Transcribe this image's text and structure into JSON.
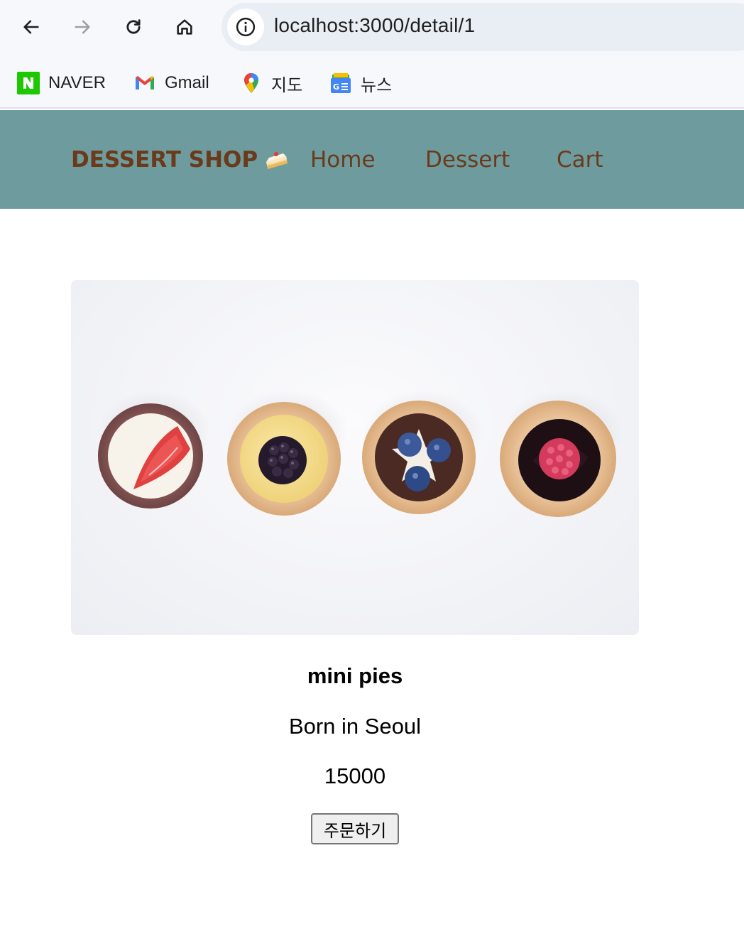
{
  "browser": {
    "url": "localhost:3000/detail/1",
    "bookmarks": [
      {
        "label": "NAVER",
        "icon": "naver-icon"
      },
      {
        "label": "Gmail",
        "icon": "gmail-icon"
      },
      {
        "label": "지도",
        "icon": "maps-icon"
      },
      {
        "label": "뉴스",
        "icon": "news-icon"
      }
    ]
  },
  "navbar": {
    "brand": "DESSERT SHOP",
    "brand_icon": "cake-icon",
    "links": [
      "Home",
      "Dessert",
      "Cart"
    ],
    "background": "#6e9b9e",
    "text_color": "#6b3a1a"
  },
  "product": {
    "title": "mini pies",
    "description": "Born in Seoul",
    "price": "15000",
    "order_label": "주문하기"
  }
}
